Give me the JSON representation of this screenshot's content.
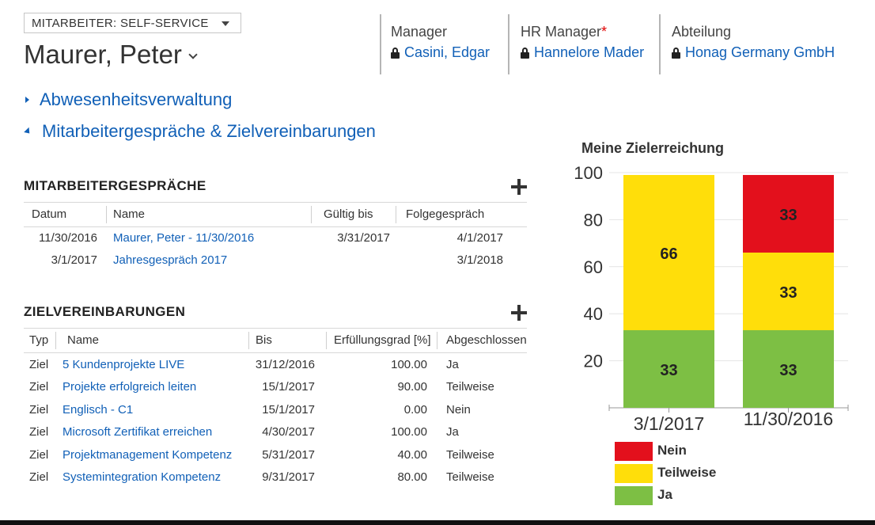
{
  "form_selector": {
    "label": "MITARBEITER: SELF-SERVICE"
  },
  "record": {
    "title": "Maurer, Peter"
  },
  "header_fields": [
    {
      "label": "Manager",
      "required": "",
      "value": "Casini, Edgar"
    },
    {
      "label": "HR Manager",
      "required": "*",
      "value": "Hannelore Mader"
    },
    {
      "label": "Abteilung",
      "required": "",
      "value": "Honag Germany GmbH"
    }
  ],
  "sections": {
    "absence": "Abwesenheitsverwaltung",
    "reviews": "Mitarbeitergespräche & Zielvereinbarungen"
  },
  "reviews_grid": {
    "title": "MITARBEITERGESPRÄCHE",
    "columns": [
      "Datum",
      "Name",
      "Gültig bis",
      "Folgegespräch"
    ],
    "rows": [
      {
        "datum": "11/30/2016",
        "name": "Maurer, Peter - 11/30/2016",
        "gueltig_bis": "3/31/2017",
        "folgegespraech": "4/1/2017"
      },
      {
        "datum": "3/1/2017",
        "name": "Jahresgespräch 2017",
        "gueltig_bis": "",
        "folgegespraech": "3/1/2018"
      }
    ]
  },
  "goals_grid": {
    "title": "ZIELVEREINBARUNGEN",
    "columns": [
      "Typ",
      "Name",
      "Bis",
      "Erfüllungsgrad [%]",
      "Abgeschlossen"
    ],
    "rows": [
      {
        "typ": "Ziel",
        "name": "5 Kundenprojekte LIVE",
        "bis": "31/12/2016",
        "grad": "100.00",
        "abgeschlossen": "Ja"
      },
      {
        "typ": "Ziel",
        "name": "Projekte erfolgreich leiten",
        "bis": "15/1/2017",
        "grad": "90.00",
        "abgeschlossen": "Teilweise"
      },
      {
        "typ": "Ziel",
        "name": "Englisch - C1",
        "bis": "15/1/2017",
        "grad": "0.00",
        "abgeschlossen": "Nein"
      },
      {
        "typ": "Ziel",
        "name": "Microsoft Zertifikat erreichen",
        "bis": "4/30/2017",
        "grad": "100.00",
        "abgeschlossen": "Ja"
      },
      {
        "typ": "Ziel",
        "name": "Projektmanagement Kompetenz",
        "bis": "5/31/2017",
        "grad": "40.00",
        "abgeschlossen": "Teilweise"
      },
      {
        "typ": "Ziel",
        "name": "Systemintegration Kompetenz",
        "bis": "9/31/2017",
        "grad": "80.00",
        "abgeschlossen": "Teilweise"
      }
    ]
  },
  "colors": {
    "link": "#1160b7",
    "nein": "#e3101c",
    "teilweise": "#ffde0a",
    "ja": "#7dbf44"
  },
  "icons": {
    "header_value": "lock-icon",
    "add": "plus-icon",
    "expand": "caret-right-icon",
    "collapse": "caret-down-icon"
  },
  "chart_data": {
    "type": "bar",
    "stacked": true,
    "title": "Meine Zielerreichung",
    "categories": [
      "3/1/2017",
      "11/30/2016"
    ],
    "series": [
      {
        "name": "Ja",
        "color": "#7dbf44",
        "values": [
          33,
          33
        ],
        "labels": [
          "33",
          "33"
        ]
      },
      {
        "name": "Teilweise",
        "color": "#ffde0a",
        "values": [
          66,
          33
        ],
        "labels": [
          "66",
          "33"
        ]
      },
      {
        "name": "Nein",
        "color": "#e3101c",
        "values": [
          0,
          33
        ],
        "labels": [
          "",
          "33"
        ]
      }
    ],
    "ylim": [
      0,
      100
    ],
    "yticks": [
      20,
      40,
      60,
      80,
      100
    ],
    "ytick_labels": [
      "20",
      "40",
      "60",
      "80",
      "100"
    ],
    "grid": true,
    "legend_position": "bottom-left",
    "legend": [
      "Nein",
      "Teilweise",
      "Ja"
    ]
  }
}
